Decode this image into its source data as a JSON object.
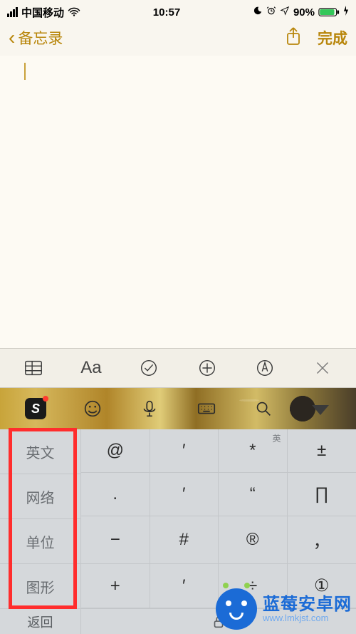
{
  "status_bar": {
    "carrier": "中国移动",
    "time": "10:57",
    "battery_pct": "90%"
  },
  "nav": {
    "back_label": "备忘录",
    "done_label": "完成"
  },
  "notes_toolbar": {
    "font_label": "Aa"
  },
  "ime_toolbar": {
    "sogou_label": "S"
  },
  "symbols": {
    "categories": [
      "英文",
      "网络",
      "单位",
      "图形"
    ],
    "grid": [
      {
        "sym": "@",
        "sup": ""
      },
      {
        "sym": "′",
        "sup": ""
      },
      {
        "sym": "*",
        "sup": "英"
      },
      {
        "sym": "±",
        "sup": ""
      },
      {
        "sym": ".",
        "sup": ""
      },
      {
        "sym": "′",
        "sup": ""
      },
      {
        "sym": "“",
        "sup": ""
      },
      {
        "sym": "∏",
        "sup": ""
      },
      {
        "sym": "−",
        "sup": ""
      },
      {
        "sym": "#",
        "sup": ""
      },
      {
        "sym": "®",
        "sup": ""
      },
      {
        "sym": "，",
        "sup": ""
      },
      {
        "sym": "+",
        "sup": ""
      },
      {
        "sym": "′",
        "sup": ""
      },
      {
        "sym": "÷",
        "sup": ""
      },
      {
        "sym": "①",
        "sup": ""
      }
    ],
    "return_label": "返回"
  },
  "watermark": {
    "brand": "蓝莓安卓网",
    "url": "www.lmkjst.com"
  }
}
